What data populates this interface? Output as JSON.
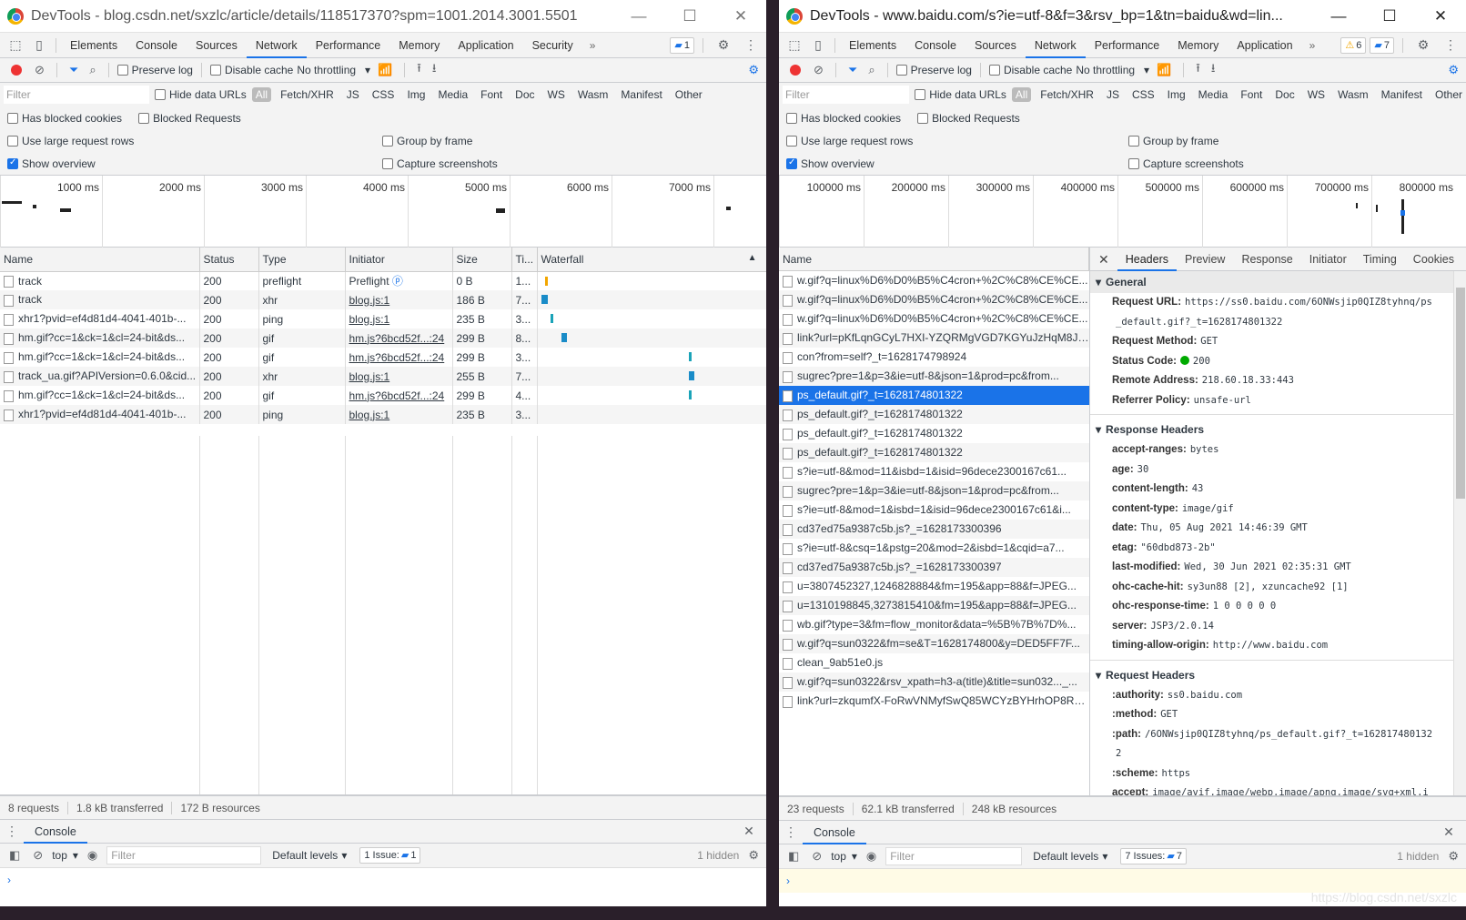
{
  "left": {
    "title": "DevTools - blog.csdn.net/sxzlc/article/details/118517370?spm=1001.2014.3001.5501",
    "tabs": [
      "Elements",
      "Console",
      "Sources",
      "Network",
      "Performance",
      "Memory",
      "Application",
      "Security"
    ],
    "active_tab": "Network",
    "issues_badge": "1",
    "toolbar": {
      "preserve_log": "Preserve log",
      "disable_cache": "Disable cache",
      "throttling": "No throttling"
    },
    "filter_placeholder": "Filter",
    "hide_data_urls": "Hide data URLs",
    "type_filters": [
      "All",
      "Fetch/XHR",
      "JS",
      "CSS",
      "Img",
      "Media",
      "Font",
      "Doc",
      "WS",
      "Wasm",
      "Manifest",
      "Other"
    ],
    "has_blocked_cookies": "Has blocked cookies",
    "blocked_requests": "Blocked Requests",
    "use_large_rows": "Use large request rows",
    "group_by_frame": "Group by frame",
    "show_overview": "Show overview",
    "capture_screenshots": "Capture screenshots",
    "overview_ticks": [
      "1000 ms",
      "2000 ms",
      "3000 ms",
      "4000 ms",
      "5000 ms",
      "6000 ms",
      "7000 ms"
    ],
    "columns": [
      "Name",
      "Status",
      "Type",
      "Initiator",
      "Size",
      "Ti...",
      "Waterfall"
    ],
    "rows": [
      {
        "name": "track",
        "status": "200",
        "type": "preflight",
        "initiator": "Preflight",
        "size": "0 B",
        "time": "1..."
      },
      {
        "name": "track",
        "status": "200",
        "type": "xhr",
        "initiator": "blog.js:1",
        "size": "186 B",
        "time": "7..."
      },
      {
        "name": "xhr1?pvid=ef4d81d4-4041-401b-...",
        "status": "200",
        "type": "ping",
        "initiator": "blog.js:1",
        "size": "235 B",
        "time": "3..."
      },
      {
        "name": "hm.gif?cc=1&ck=1&cl=24-bit&ds...",
        "status": "200",
        "type": "gif",
        "initiator": "hm.js?6bcd52f...:24",
        "size": "299 B",
        "time": "8..."
      },
      {
        "name": "hm.gif?cc=1&ck=1&cl=24-bit&ds...",
        "status": "200",
        "type": "gif",
        "initiator": "hm.js?6bcd52f...:24",
        "size": "299 B",
        "time": "3..."
      },
      {
        "name": "track_ua.gif?APIVersion=0.6.0&cid...",
        "status": "200",
        "type": "xhr",
        "initiator": "blog.js:1",
        "size": "255 B",
        "time": "7..."
      },
      {
        "name": "hm.gif?cc=1&ck=1&cl=24-bit&ds...",
        "status": "200",
        "type": "gif",
        "initiator": "hm.js?6bcd52f...:24",
        "size": "299 B",
        "time": "4..."
      },
      {
        "name": "xhr1?pvid=ef4d81d4-4041-401b-...",
        "status": "200",
        "type": "ping",
        "initiator": "blog.js:1",
        "size": "235 B",
        "time": "3..."
      }
    ],
    "status_bar": {
      "requests": "8 requests",
      "transferred": "1.8 kB transferred",
      "resources": "172 B resources"
    },
    "console": {
      "tab": "Console",
      "context": "top",
      "filter": "Filter",
      "levels": "Default levels",
      "issues_label": "1 Issue:",
      "issues_count": "1",
      "hidden": "1 hidden",
      "prompt": "›"
    }
  },
  "right": {
    "title": "DevTools - www.baidu.com/s?ie=utf-8&f=3&rsv_bp=1&tn=baidu&wd=lin...",
    "tabs": [
      "Elements",
      "Console",
      "Sources",
      "Network",
      "Performance",
      "Memory",
      "Application"
    ],
    "active_tab": "Network",
    "warnings_badge": "6",
    "issues_badge": "7",
    "toolbar": {
      "preserve_log": "Preserve log",
      "disable_cache": "Disable cache",
      "throttling": "No throttling"
    },
    "filter_placeholder": "Filter",
    "hide_data_urls": "Hide data URLs",
    "type_filters": [
      "All",
      "Fetch/XHR",
      "JS",
      "CSS",
      "Img",
      "Media",
      "Font",
      "Doc",
      "WS",
      "Wasm",
      "Manifest",
      "Other"
    ],
    "has_blocked_cookies": "Has blocked cookies",
    "blocked_requests": "Blocked Requests",
    "use_large_rows": "Use large request rows",
    "group_by_frame": "Group by frame",
    "show_overview": "Show overview",
    "capture_screenshots": "Capture screenshots",
    "overview_ticks": [
      "100000 ms",
      "200000 ms",
      "300000 ms",
      "400000 ms",
      "500000 ms",
      "600000 ms",
      "700000 ms",
      "800000 ms"
    ],
    "name_col": "Name",
    "requests": [
      "w.gif?q=linux%D6%D0%B5%C4cron+%2C%C8%CE%CE...",
      "w.gif?q=linux%D6%D0%B5%C4cron+%2C%C8%CE%CE...",
      "w.gif?q=linux%D6%D0%B5%C4cron+%2C%C8%CE%CE...",
      "link?url=pKfLqnGCyL7HXI-YZQRMgVGD7KGYuJzHqM8Jx...",
      "con?from=self?_t=1628174798924",
      "sugrec?pre=1&p=3&ie=utf-8&json=1&prod=pc&from...",
      "ps_default.gif?_t=1628174801322",
      "ps_default.gif?_t=1628174801322",
      "ps_default.gif?_t=1628174801322",
      "ps_default.gif?_t=1628174801322",
      "s?ie=utf-8&mod=11&isbd=1&isid=96dece2300167c61...",
      "sugrec?pre=1&p=3&ie=utf-8&json=1&prod=pc&from...",
      "s?ie=utf-8&mod=1&isbd=1&isid=96dece2300167c61&i...",
      "cd37ed75a9387c5b.js?_=1628173300396",
      "s?ie=utf-8&csq=1&pstg=20&mod=2&isbd=1&cqid=a7...",
      "cd37ed75a9387c5b.js?_=1628173300397",
      "u=3807452327,1246828884&fm=195&app=88&f=JPEG...",
      "u=1310198845,3273815410&fm=195&app=88&f=JPEG...",
      "wb.gif?type=3&fm=flow_monitor&data=%5B%7B%7D%...",
      "w.gif?q=sun0322&fm=se&T=1628174800&y=DED5FF7F...",
      "clean_9ab51e0.js",
      "w.gif?q=sun0322&rsv_xpath=h3-a(title)&title=sun032..._...",
      "link?url=zkqumfX-FoRwVNMyfSwQ85WCYzBYHrhOP8RG..."
    ],
    "selected_index": 6,
    "detail_tabs": [
      "Headers",
      "Preview",
      "Response",
      "Initiator",
      "Timing",
      "Cookies"
    ],
    "general": {
      "heading": "General",
      "items": [
        {
          "k": "Request URL:",
          "v": "https://ss0.baidu.com/6ONWsjip0QIZ8tyhnq/ps"
        },
        {
          "k": "",
          "v": "_default.gif?_t=1628174801322"
        },
        {
          "k": "Request Method:",
          "v": "GET"
        },
        {
          "k": "Status Code:",
          "v": "200"
        },
        {
          "k": "Remote Address:",
          "v": "218.60.18.33:443"
        },
        {
          "k": "Referrer Policy:",
          "v": "unsafe-url"
        }
      ]
    },
    "response_headers": {
      "heading": "Response Headers",
      "items": [
        {
          "k": "accept-ranges:",
          "v": "bytes"
        },
        {
          "k": "age:",
          "v": "30"
        },
        {
          "k": "content-length:",
          "v": "43"
        },
        {
          "k": "content-type:",
          "v": "image/gif"
        },
        {
          "k": "date:",
          "v": "Thu, 05 Aug 2021 14:46:39 GMT"
        },
        {
          "k": "etag:",
          "v": "\"60dbd873-2b\""
        },
        {
          "k": "last-modified:",
          "v": "Wed, 30 Jun 2021 02:35:31 GMT"
        },
        {
          "k": "ohc-cache-hit:",
          "v": "sy3un88 [2], xzuncache92 [1]"
        },
        {
          "k": "ohc-response-time:",
          "v": "1 0 0 0 0 0"
        },
        {
          "k": "server:",
          "v": "JSP3/2.0.14"
        },
        {
          "k": "timing-allow-origin:",
          "v": "http://www.baidu.com"
        }
      ]
    },
    "request_headers": {
      "heading": "Request Headers",
      "items": [
        {
          "k": ":authority:",
          "v": "ss0.baidu.com"
        },
        {
          "k": ":method:",
          "v": "GET"
        },
        {
          "k": ":path:",
          "v": "/6ONWsjip0QIZ8tyhnq/ps_default.gif?_t=162817480132"
        },
        {
          "k": "",
          "v": "2"
        },
        {
          "k": ":scheme:",
          "v": "https"
        },
        {
          "k": "accept:",
          "v": "image/avif,image/webp,image/apng,image/svg+xml,i"
        }
      ]
    },
    "status_bar": {
      "requests": "23 requests",
      "transferred": "62.1 kB transferred",
      "resources": "248 kB resources"
    },
    "console": {
      "tab": "Console",
      "context": "top",
      "filter": "Filter",
      "levels": "Default levels",
      "issues_label": "7 Issues:",
      "issues_count": "7",
      "hidden": "1 hidden",
      "prompt": "›"
    }
  },
  "watermark": "https://blog.csdn.net/sxzlc",
  "colors": {
    "accent": "#1a73e8",
    "record": "#e33333",
    "selected_row": "#1a73e8"
  }
}
